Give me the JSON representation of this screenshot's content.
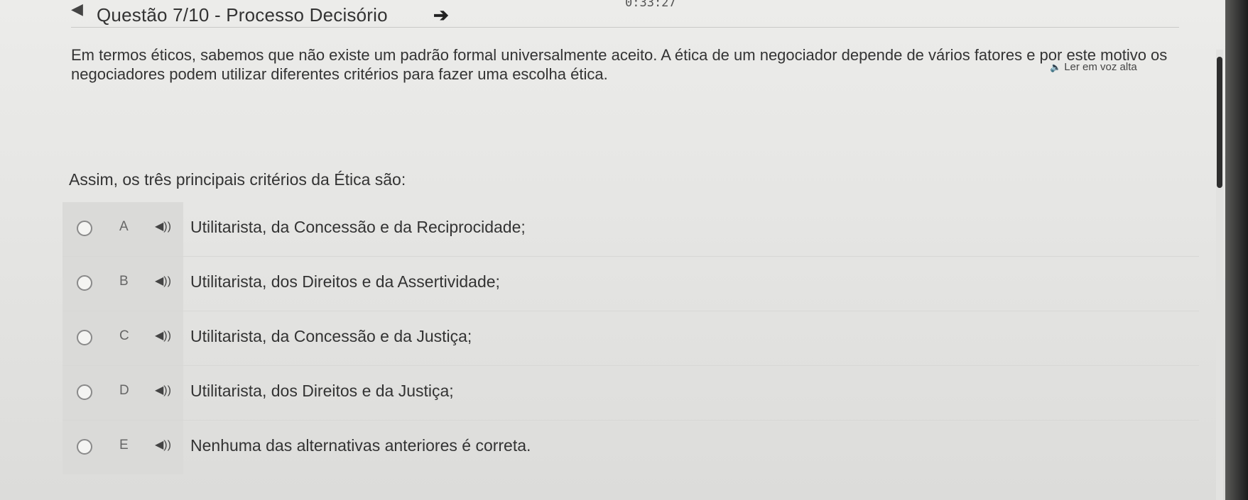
{
  "header": {
    "timer": "0:33:27",
    "title": "Questão 7/10 - Processo Decisório"
  },
  "read_aloud": {
    "label": "Ler em voz alta"
  },
  "question": {
    "statement_line1": "Em termos éticos, sabemos que não existe um padrão formal universalmente aceito. A ética de um negociador depende de vários fatores e por este motivo os",
    "statement_line2": "negociadores podem utilizar diferentes critérios para fazer uma escolha ética.",
    "prompt": "Assim, os três principais critérios da Ética são:"
  },
  "options": [
    {
      "letter": "A",
      "text": "Utilitarista, da Concessão e da Reciprocidade;"
    },
    {
      "letter": "B",
      "text": "Utilitarista, dos Direitos e da Assertividade;"
    },
    {
      "letter": "C",
      "text": "Utilitarista, da Concessão e da Justiça;"
    },
    {
      "letter": "D",
      "text": "Utilitarista, dos Direitos e da Justiça;"
    },
    {
      "letter": "E",
      "text": "Nenhuma das alternativas anteriores é correta."
    }
  ],
  "icons": {
    "back": "arrow-left-icon",
    "next": "arrow-right-icon",
    "speaker": "speaker-icon"
  }
}
